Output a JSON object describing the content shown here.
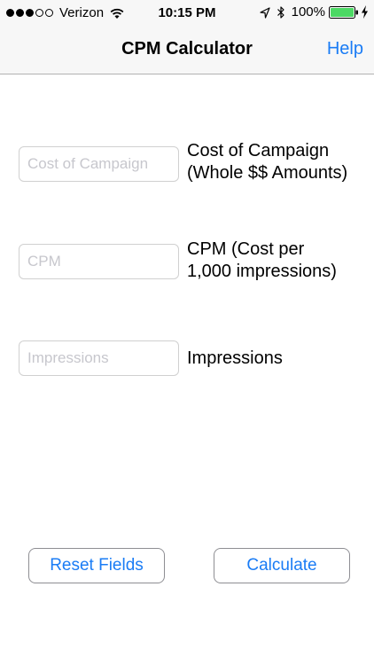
{
  "status_bar": {
    "carrier": "Verizon",
    "time": "10:15 PM",
    "battery": "100%"
  },
  "nav": {
    "title": "CPM Calculator",
    "help_label": "Help"
  },
  "fields": [
    {
      "placeholder": "Cost of Campaign",
      "value": "",
      "label_lines": [
        "Cost of Campaign",
        "(Whole $$ Amounts)"
      ]
    },
    {
      "placeholder": "CPM",
      "value": "",
      "label_lines": [
        "CPM (Cost per",
        "1,000 impressions)"
      ]
    },
    {
      "placeholder": "Impressions",
      "value": "",
      "label_lines": [
        "Impressions"
      ]
    }
  ],
  "buttons": {
    "reset_label": "Reset Fields",
    "calculate_label": "Calculate"
  },
  "colors": {
    "accent": "#1a7cf5",
    "battery_green": "#4cd964",
    "bar_background": "#f7f7f7"
  },
  "icons": [
    "signal-strength-icon",
    "wifi-icon",
    "location-arrow-icon",
    "bluetooth-icon",
    "battery-icon",
    "charging-bolt-icon"
  ]
}
